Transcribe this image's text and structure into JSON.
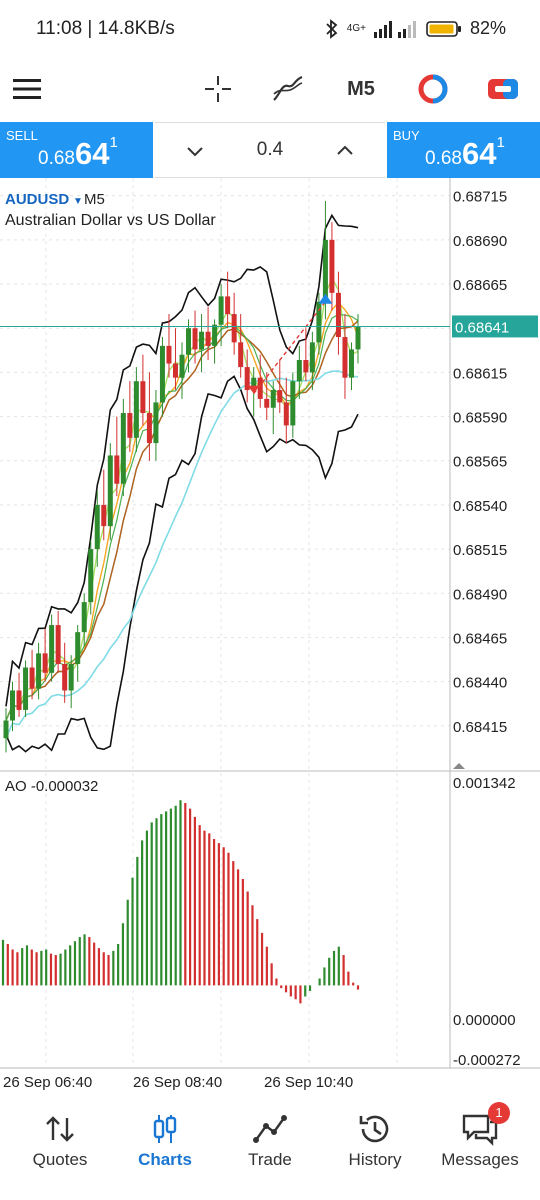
{
  "status_bar": {
    "time_speed": "11:08 | 14.8KB/s",
    "network": "4G+",
    "battery": "82%"
  },
  "toolbar": {
    "menu_icon": "hamburger-menu-icon",
    "crosshair_icon": "crosshair-icon",
    "indicators_icon": "indicators-icon",
    "timeframe": "M5",
    "objects_icon": "objects-icon",
    "trade_icon": "new-order-icon"
  },
  "trade_panel": {
    "sell_label": "SELL",
    "sell_price_prefix": "0.68",
    "sell_price_main": "64",
    "sell_price_sup": "1",
    "volume": "0.4",
    "buy_label": "BUY",
    "buy_price_prefix": "0.68",
    "buy_price_main": "64",
    "buy_price_sup": "1",
    "sell_color": "#2196f3",
    "buy_color": "#2196f3"
  },
  "chart_data": [
    {
      "type": "candlestick",
      "symbol": "AUDUSD",
      "timeframe": "M5",
      "description": "Australian Dollar vs US Dollar",
      "ylim": [
        0.6839,
        0.68725
      ],
      "y_ticks": [
        "0.68715",
        "0.68690",
        "0.68665",
        "0.68640",
        "0.68615",
        "0.68590",
        "0.68565",
        "0.68540",
        "0.68515",
        "0.68490",
        "0.68465",
        "0.68440",
        "0.68415"
      ],
      "current_price": "0.68641",
      "current_price_value": 0.68641,
      "grid": true,
      "up_color": "#2e8b2e",
      "down_color": "#d32f2f",
      "candles": [
        [
          0.68408,
          0.68425,
          0.684,
          0.68418
        ],
        [
          0.68418,
          0.6844,
          0.68412,
          0.68435
        ],
        [
          0.68435,
          0.68445,
          0.6842,
          0.68424
        ],
        [
          0.68424,
          0.68452,
          0.6842,
          0.68448
        ],
        [
          0.68448,
          0.68458,
          0.6843,
          0.68436
        ],
        [
          0.68436,
          0.68462,
          0.6843,
          0.68456
        ],
        [
          0.68456,
          0.6847,
          0.6844,
          0.68445
        ],
        [
          0.68445,
          0.68478,
          0.6844,
          0.68472
        ],
        [
          0.68472,
          0.6848,
          0.68445,
          0.6845
        ],
        [
          0.6845,
          0.68462,
          0.68428,
          0.68435
        ],
        [
          0.68435,
          0.68455,
          0.68425,
          0.6845
        ],
        [
          0.6845,
          0.68472,
          0.6844,
          0.68468
        ],
        [
          0.68468,
          0.6849,
          0.6846,
          0.68485
        ],
        [
          0.68485,
          0.6852,
          0.68478,
          0.68515
        ],
        [
          0.68515,
          0.68548,
          0.68505,
          0.6854
        ],
        [
          0.6854,
          0.6856,
          0.6852,
          0.68528
        ],
        [
          0.68528,
          0.68575,
          0.6852,
          0.68568
        ],
        [
          0.68568,
          0.6859,
          0.68545,
          0.68552
        ],
        [
          0.68552,
          0.686,
          0.68545,
          0.68592
        ],
        [
          0.68592,
          0.6861,
          0.6857,
          0.68578
        ],
        [
          0.68578,
          0.68618,
          0.6857,
          0.6861
        ],
        [
          0.6861,
          0.68625,
          0.68585,
          0.68592
        ],
        [
          0.68592,
          0.68615,
          0.68565,
          0.68575
        ],
        [
          0.68575,
          0.68605,
          0.68565,
          0.68598
        ],
        [
          0.68598,
          0.68635,
          0.6859,
          0.6863
        ],
        [
          0.6863,
          0.68648,
          0.68612,
          0.6862
        ],
        [
          0.6862,
          0.6864,
          0.68605,
          0.68612
        ],
        [
          0.68612,
          0.68632,
          0.686,
          0.68625
        ],
        [
          0.68625,
          0.68645,
          0.68615,
          0.6864
        ],
        [
          0.6864,
          0.6865,
          0.6862,
          0.68628
        ],
        [
          0.68628,
          0.68648,
          0.68615,
          0.68638
        ],
        [
          0.68638,
          0.68652,
          0.68622,
          0.6863
        ],
        [
          0.6863,
          0.68645,
          0.6862,
          0.68642
        ],
        [
          0.68642,
          0.68665,
          0.6863,
          0.68658
        ],
        [
          0.68658,
          0.68672,
          0.6864,
          0.68648
        ],
        [
          0.68648,
          0.6866,
          0.68625,
          0.68632
        ],
        [
          0.68632,
          0.68648,
          0.68612,
          0.68618
        ],
        [
          0.68618,
          0.68628,
          0.68598,
          0.68605
        ],
        [
          0.68605,
          0.68618,
          0.6859,
          0.68612
        ],
        [
          0.68612,
          0.68625,
          0.68595,
          0.686
        ],
        [
          0.686,
          0.68615,
          0.68588,
          0.68595
        ],
        [
          0.68595,
          0.6861,
          0.6858,
          0.68605
        ],
        [
          0.68605,
          0.68622,
          0.68592,
          0.68598
        ],
        [
          0.68598,
          0.68612,
          0.68575,
          0.68585
        ],
        [
          0.68585,
          0.68615,
          0.68578,
          0.6861
        ],
        [
          0.6861,
          0.6863,
          0.686,
          0.68622
        ],
        [
          0.68622,
          0.6864,
          0.6861,
          0.68615
        ],
        [
          0.68615,
          0.68638,
          0.68605,
          0.68632
        ],
        [
          0.68632,
          0.6866,
          0.68625,
          0.68655
        ],
        [
          0.68655,
          0.68712,
          0.68645,
          0.6869
        ],
        [
          0.6869,
          0.687,
          0.6865,
          0.6866
        ],
        [
          0.6866,
          0.68672,
          0.68625,
          0.68635
        ],
        [
          0.68635,
          0.68648,
          0.686,
          0.68612
        ],
        [
          0.68612,
          0.68632,
          0.68605,
          0.68628
        ],
        [
          0.68628,
          0.68648,
          0.6862,
          0.68641
        ]
      ]
    },
    {
      "type": "bar",
      "indicator": "AO",
      "label": "AO -0.000032",
      "y_ticks": [
        "0.001342",
        "0.000000",
        "-0.000272"
      ],
      "ylim": [
        -0.000272,
        0.001342
      ],
      "up_color": "#2e8b2e",
      "down_color": "#d32f2f",
      "x_labels": [
        "26 Sep 06:40",
        "26 Sep 08:40",
        "26 Sep 10:40"
      ],
      "values": [
        0.00033,
        0.0003,
        0.00026,
        0.00024,
        0.00027,
        0.00029,
        0.00026,
        0.00024,
        0.00025,
        0.00026,
        0.00023,
        0.00022,
        0.00023,
        0.00026,
        0.00029,
        0.00032,
        0.00035,
        0.00037,
        0.00035,
        0.00031,
        0.00027,
        0.00024,
        0.00022,
        0.00025,
        0.0003,
        0.00045,
        0.00062,
        0.00078,
        0.00093,
        0.00105,
        0.00112,
        0.00118,
        0.00121,
        0.00124,
        0.00126,
        0.00128,
        0.0013,
        0.00134,
        0.00132,
        0.00128,
        0.00122,
        0.00116,
        0.00112,
        0.0011,
        0.00106,
        0.00103,
        0.001,
        0.00096,
        0.0009,
        0.00084,
        0.00077,
        0.00068,
        0.00058,
        0.00048,
        0.00038,
        0.00028,
        0.00016,
        5e-05,
        -2e-05,
        -5e-05,
        -8e-05,
        -0.0001,
        -0.00013,
        -8e-05,
        -4e-05,
        0.0,
        5e-05,
        0.00013,
        0.0002,
        0.00025,
        0.00028,
        0.00022,
        0.0001,
        2e-05,
        -3e-05
      ]
    }
  ],
  "chart_text": {
    "symbol": "AUDUSD",
    "timeframe": "M5",
    "description": "Australian Dollar vs US Dollar",
    "current_price": "0.68641",
    "ao_label": "AO -0.000032",
    "ao_top": "0.001342",
    "ao_zero": "0.000000",
    "ao_bottom": "-0.000272",
    "x1": "26 Sep 06:40",
    "x2": "26 Sep 08:40",
    "x3": "26 Sep 10:40"
  },
  "bottom_nav": {
    "quotes": "Quotes",
    "charts": "Charts",
    "trade": "Trade",
    "history": "History",
    "messages": "Messages",
    "messages_badge": "1",
    "active_color": "#1976d2"
  }
}
